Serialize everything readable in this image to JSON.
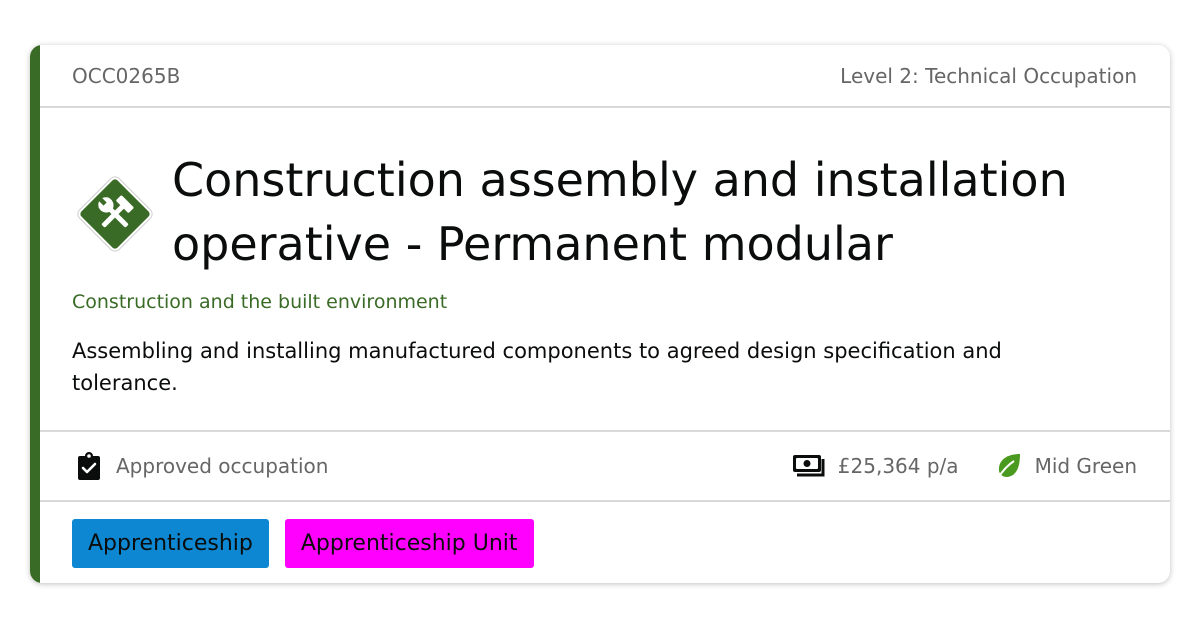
{
  "occupation": {
    "code": "OCC0265B",
    "level": "Level 2: Technical Occupation",
    "title": "Construction assembly and installation operative - Permanent modular",
    "route": "Construction and the built environment",
    "description": "Assembling and installing manufactured components to agreed design specification and tolerance.",
    "route_icon": "tools-icon",
    "route_color": "#3a6b26"
  },
  "meta": {
    "status": {
      "icon": "clipboard-check-icon",
      "label": "Approved occupation"
    },
    "salary": {
      "icon": "money-icon",
      "label": "£25,364 p/a"
    },
    "green": {
      "icon": "leaf-icon",
      "label": "Mid Green",
      "color": "#4a9a1f"
    }
  },
  "tags": [
    {
      "label": "Apprenticeship",
      "color": "#0d87d1"
    },
    {
      "label": "Apprenticeship Unit",
      "color": "#ff00ff"
    }
  ]
}
